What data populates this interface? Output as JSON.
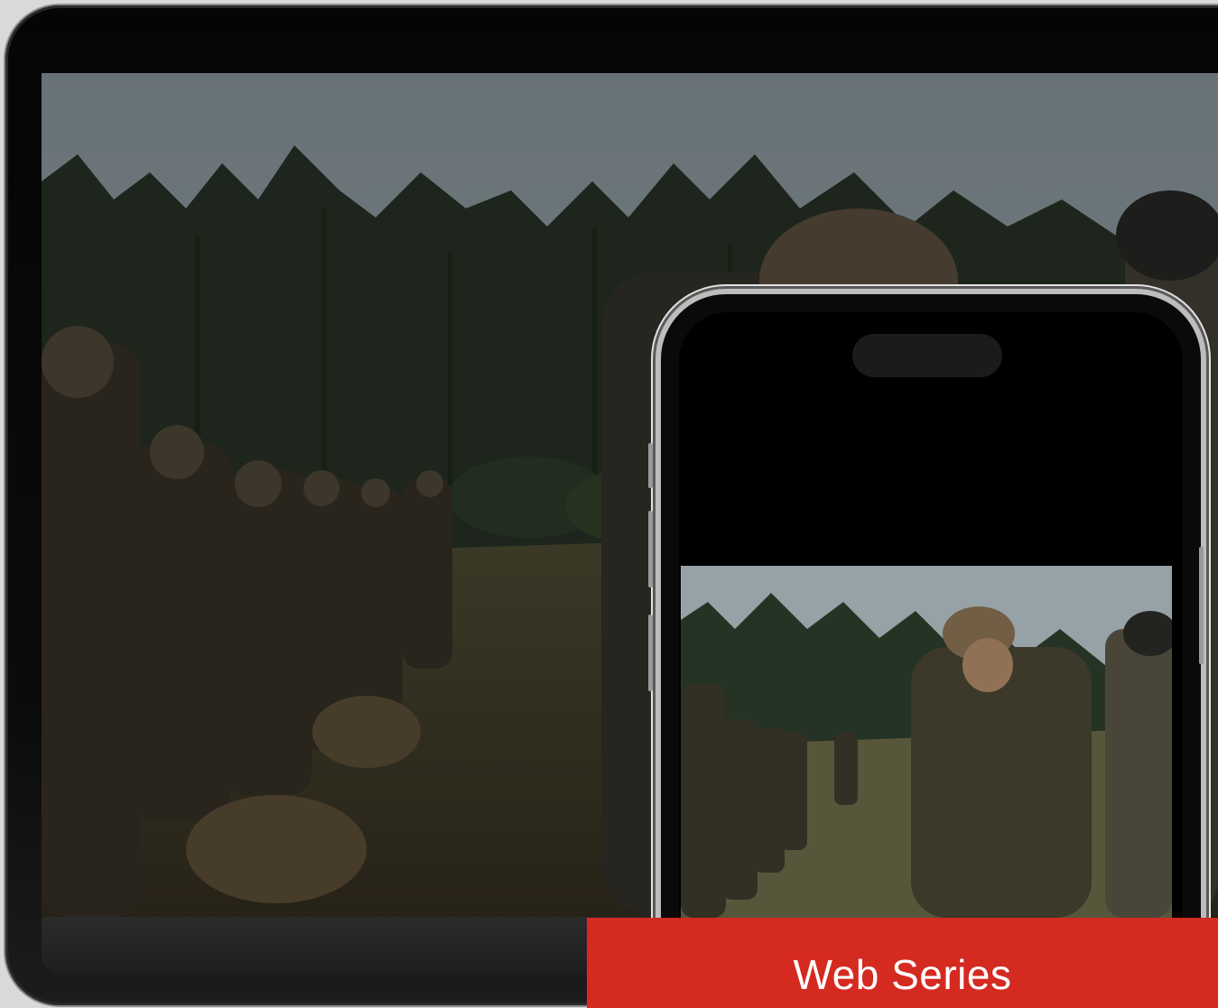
{
  "banner": {
    "title": "Web Series"
  },
  "colors": {
    "accent": "#d42a20",
    "bezel": "#0b0b0b",
    "sky": "#a9b7bd"
  },
  "media": {
    "main_video": "soldiers-in-field",
    "phone_video": "soldiers-in-field"
  }
}
